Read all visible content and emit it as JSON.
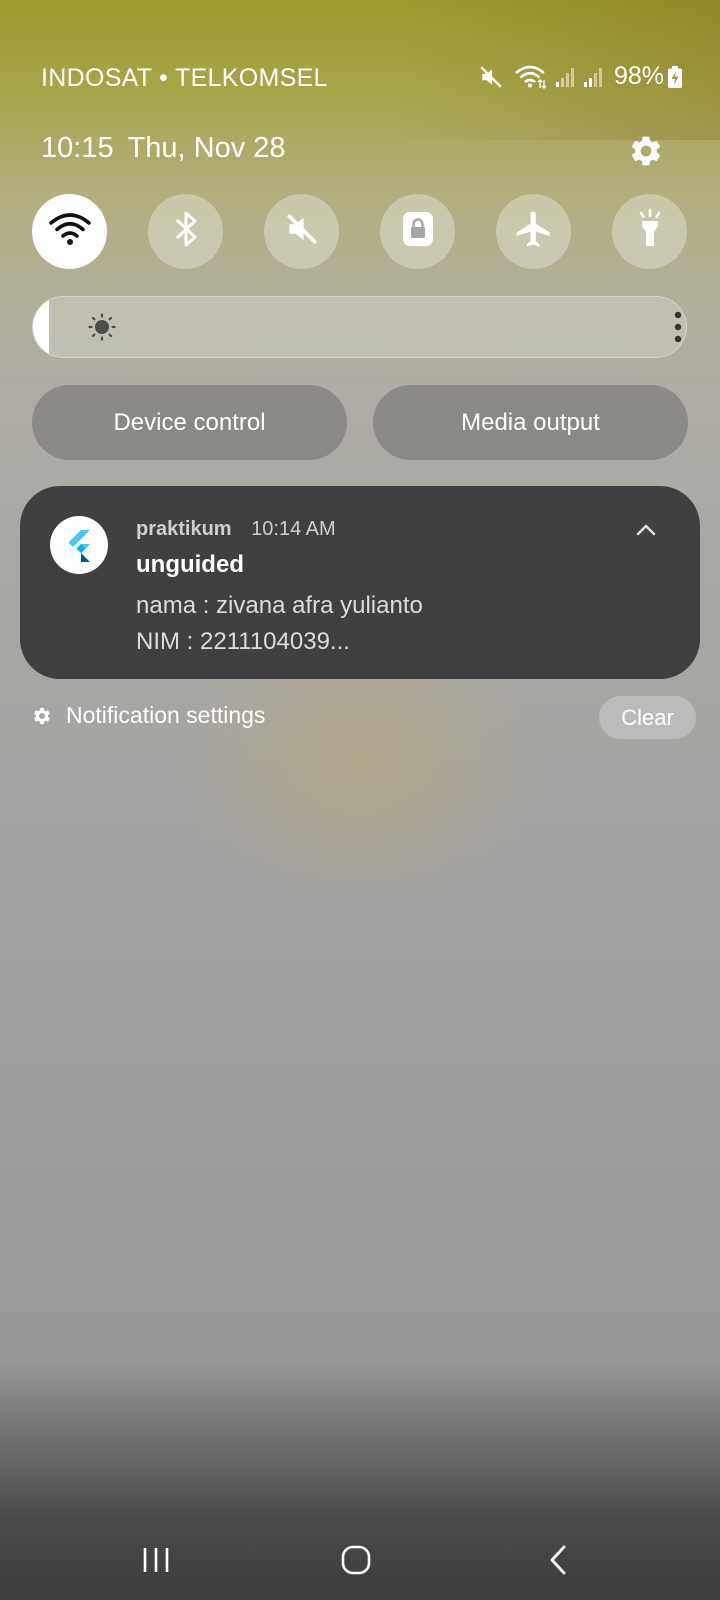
{
  "status_bar": {
    "carrier": "INDOSAT • TELKOMSEL",
    "battery_percent": "98%",
    "icons": [
      "mute-icon",
      "wifi-icon",
      "signal-icon",
      "signal-icon",
      "battery-charging-icon"
    ]
  },
  "header": {
    "time": "10:15",
    "date": "Thu, Nov 28",
    "settings_icon": "gear-icon"
  },
  "quick_toggles": [
    {
      "name": "wifi",
      "icon": "wifi-icon",
      "active": true
    },
    {
      "name": "bluetooth",
      "icon": "bluetooth-icon",
      "active": false
    },
    {
      "name": "sound",
      "icon": "mute-icon",
      "active": false
    },
    {
      "name": "rotation-lock",
      "icon": "lock-icon",
      "active": false
    },
    {
      "name": "airplane-mode",
      "icon": "airplane-icon",
      "active": false
    },
    {
      "name": "flashlight",
      "icon": "flashlight-icon",
      "active": false
    }
  ],
  "brightness": {
    "level": 0.02,
    "icon": "sun-icon",
    "more_icon": "more-vertical-icon"
  },
  "buttons": {
    "device_control": "Device control",
    "media_output": "Media output"
  },
  "notification": {
    "app_name": "praktikum",
    "time": "10:14 AM",
    "title": "unguided",
    "lines": [
      "nama : zivana afra yulianto",
      "NIM : 2211104039..."
    ],
    "app_icon": "flutter-logo-icon"
  },
  "notification_footer": {
    "settings_label": "Notification settings",
    "clear_label": "Clear"
  },
  "nav_bar": {
    "recents_icon": "recents-icon",
    "home_icon": "home-icon",
    "back_icon": "back-icon"
  },
  "colors": {
    "card_background": "#404040",
    "toggle_active": "#ffffff"
  }
}
